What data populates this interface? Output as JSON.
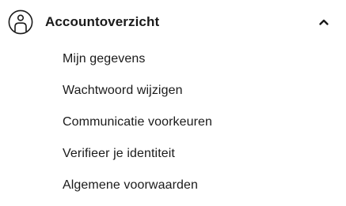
{
  "account_menu": {
    "icon": "account-icon",
    "title": "Accountoverzicht",
    "expanded": true,
    "chevron_icon": "chevron-up-icon",
    "items": [
      {
        "label": "Mijn gegevens"
      },
      {
        "label": "Wachtwoord wijzigen"
      },
      {
        "label": "Communicatie voorkeuren"
      },
      {
        "label": "Verifieer je identiteit"
      },
      {
        "label": "Algemene voorwaarden"
      }
    ]
  }
}
